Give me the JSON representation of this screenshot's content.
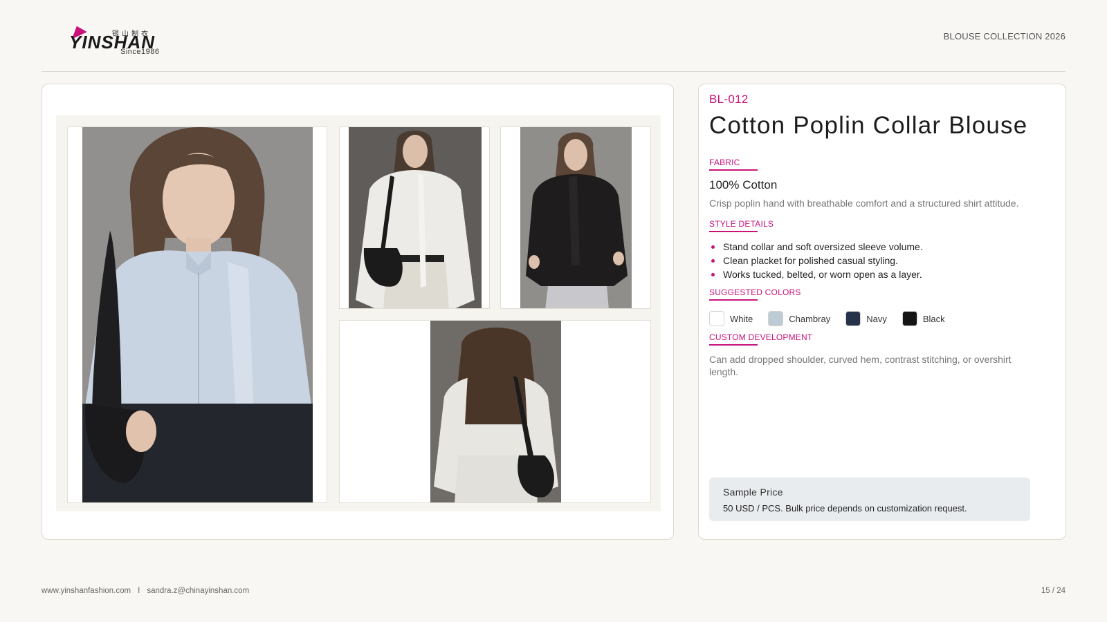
{
  "brand": {
    "logo_main": "YINSHAN",
    "logo_cn": "银山制衣",
    "logo_since": "Since1986"
  },
  "header": {
    "collection": "BLOUSE COLLECTION 2026"
  },
  "gallery": {
    "photos": [
      {
        "description": "Model in light blue poplin blouse with scarf collar and black shoulder bag, front close-up",
        "colors": {
          "bg": "#8e8d8a",
          "garment": "#c9d4e2",
          "pants": "#23262c",
          "hair": "#5a4536"
        }
      },
      {
        "description": "Model in white blouse with black bag and cream trousers",
        "colors": {
          "bg": "#5f5c59",
          "garment": "#ecebe7",
          "pants": "#dedbd3",
          "hair": "#4a3b31"
        }
      },
      {
        "description": "Model in black blouse, front view",
        "colors": {
          "bg": "#8f8e8b",
          "garment": "#1f1c1d",
          "pants": "#c8c8cc",
          "hair": "#5b4536"
        }
      },
      {
        "description": "Model in white blouse, back view with black bag",
        "colors": {
          "bg": "#6f6b67",
          "garment": "#e8e6e1",
          "pants": "#e2e0da",
          "hair": "#4a3628"
        }
      }
    ]
  },
  "product": {
    "code": "BL-012",
    "title": "Cotton Poplin Collar Blouse",
    "fabric_label": "FABRIC",
    "fabric_value": "100% Cotton",
    "fabric_desc": "Crisp poplin hand with breathable comfort and a structured shirt attitude.",
    "style_label": "STYLE DETAILS",
    "style_details": [
      "Stand collar and soft oversized sleeve volume.",
      "Clean placket for polished casual styling.",
      "Works tucked, belted, or worn open as a layer."
    ],
    "colors_label": "SUGGESTED COLORS",
    "colors": [
      {
        "name": "White",
        "hex": "#ffffff"
      },
      {
        "name": "Chambray",
        "hex": "#bccbd6"
      },
      {
        "name": "Navy",
        "hex": "#26324a"
      },
      {
        "name": "Black",
        "hex": "#151515"
      }
    ],
    "custom_label": "CUSTOM DEVELOPMENT",
    "custom_desc": "Can add dropped shoulder, curved hem, contrast stitching, or overshirt length.",
    "price_label": "Sample Price",
    "price_text": "50 USD / PCS. Bulk price depends on customization request."
  },
  "footer": {
    "website": "www.yinshanfashion.com",
    "separator": "I",
    "email": "sandra.z@chinayinshan.com",
    "page": "15 / 24"
  },
  "accent": "#c8127a"
}
